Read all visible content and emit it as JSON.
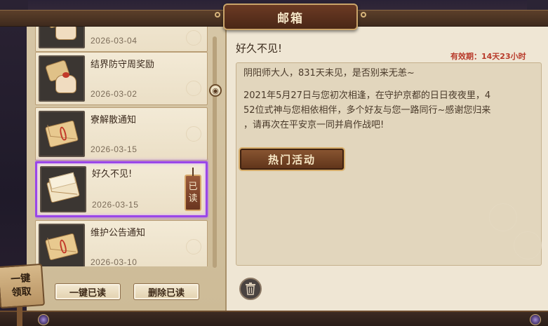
{
  "window": {
    "title": "邮箱"
  },
  "mail_list": [
    {
      "title": "",
      "date": "2026-03-04",
      "icon": "gift-icon"
    },
    {
      "title": "结界防守周奖励",
      "date": "2026-03-02",
      "icon": "gift-icon"
    },
    {
      "title": "寮解散通知",
      "date": "2026-03-15",
      "icon": "envelope-icon"
    },
    {
      "title": "好久不见!",
      "date": "2026-03-15",
      "icon": "open-envelope-icon",
      "selected": true,
      "read_tag": [
        "已",
        "读"
      ]
    },
    {
      "title": "维护公告通知",
      "date": "2026-03-10",
      "icon": "envelope-icon"
    }
  ],
  "buttons": {
    "mark_all_read": "一键已读",
    "delete_read": "删除已读",
    "claim_all": [
      "一键",
      "领取"
    ],
    "hot_event": "热门活动"
  },
  "detail": {
    "title": "好久不见!",
    "expiry": "有效期：14天23小时",
    "greeting": "阴阳师大人，831天未见，是否别来无恙~",
    "body_lines": [
      "2021年5月27日与您初次相逢，在守护京都的日日夜夜里，4",
      "52位式神与您相依相伴，多个好友与您一路同行~感谢您归来",
      "，请再次在平安京一同并肩作战吧!"
    ]
  },
  "colors": {
    "accent_purple": "#9a46e8",
    "expiry_red": "#b83a2a",
    "wood": "#6b3a24"
  }
}
